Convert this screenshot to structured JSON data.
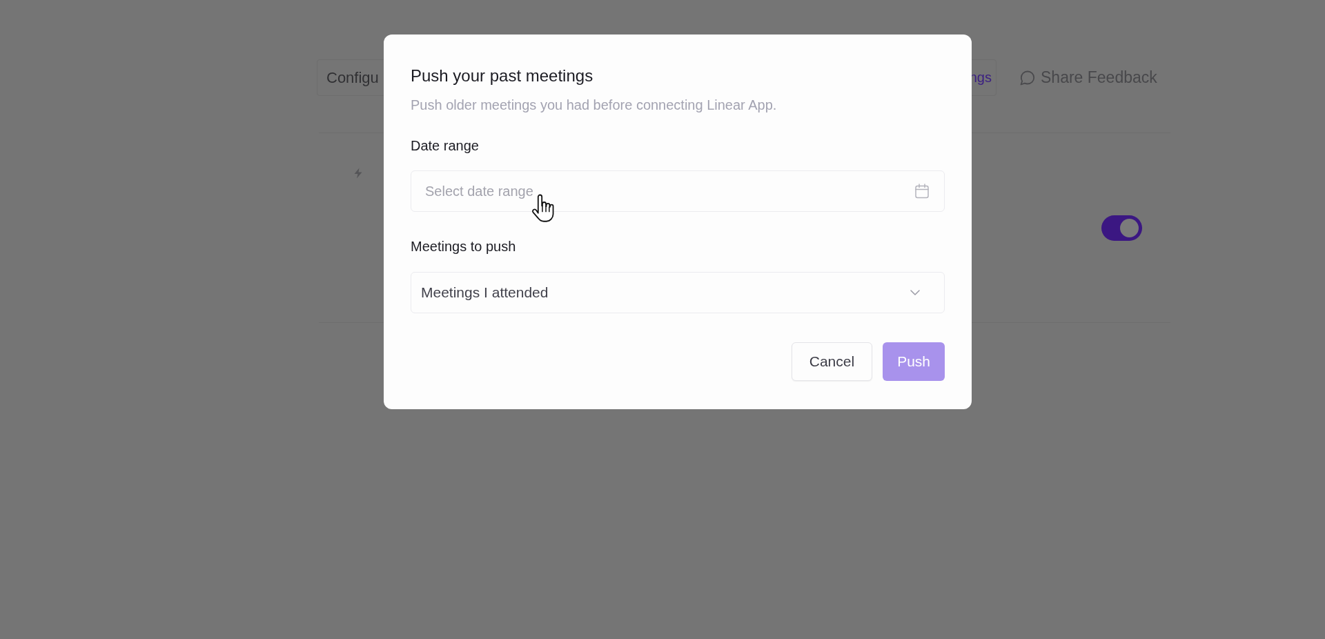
{
  "background": {
    "tabs": [
      {
        "label": "Configu",
        "selected": false
      },
      {
        "label": "ngs",
        "selected": true
      }
    ],
    "feedback_link": "Share Feedback",
    "toggle": {
      "on": true
    }
  },
  "dialog": {
    "title": "Push your past meetings",
    "subtitle": "Push older meetings you had before connecting Linear App.",
    "fields": [
      {
        "kind": "date",
        "label": "Date range",
        "placeholder": "Select date range"
      },
      {
        "kind": "select",
        "label": "Meetings to push",
        "value": "Meetings I attended"
      }
    ],
    "buttons": [
      {
        "label": "Cancel",
        "kind": "secondary",
        "disabled": false
      },
      {
        "label": "Push",
        "kind": "primary",
        "disabled": true
      }
    ]
  }
}
